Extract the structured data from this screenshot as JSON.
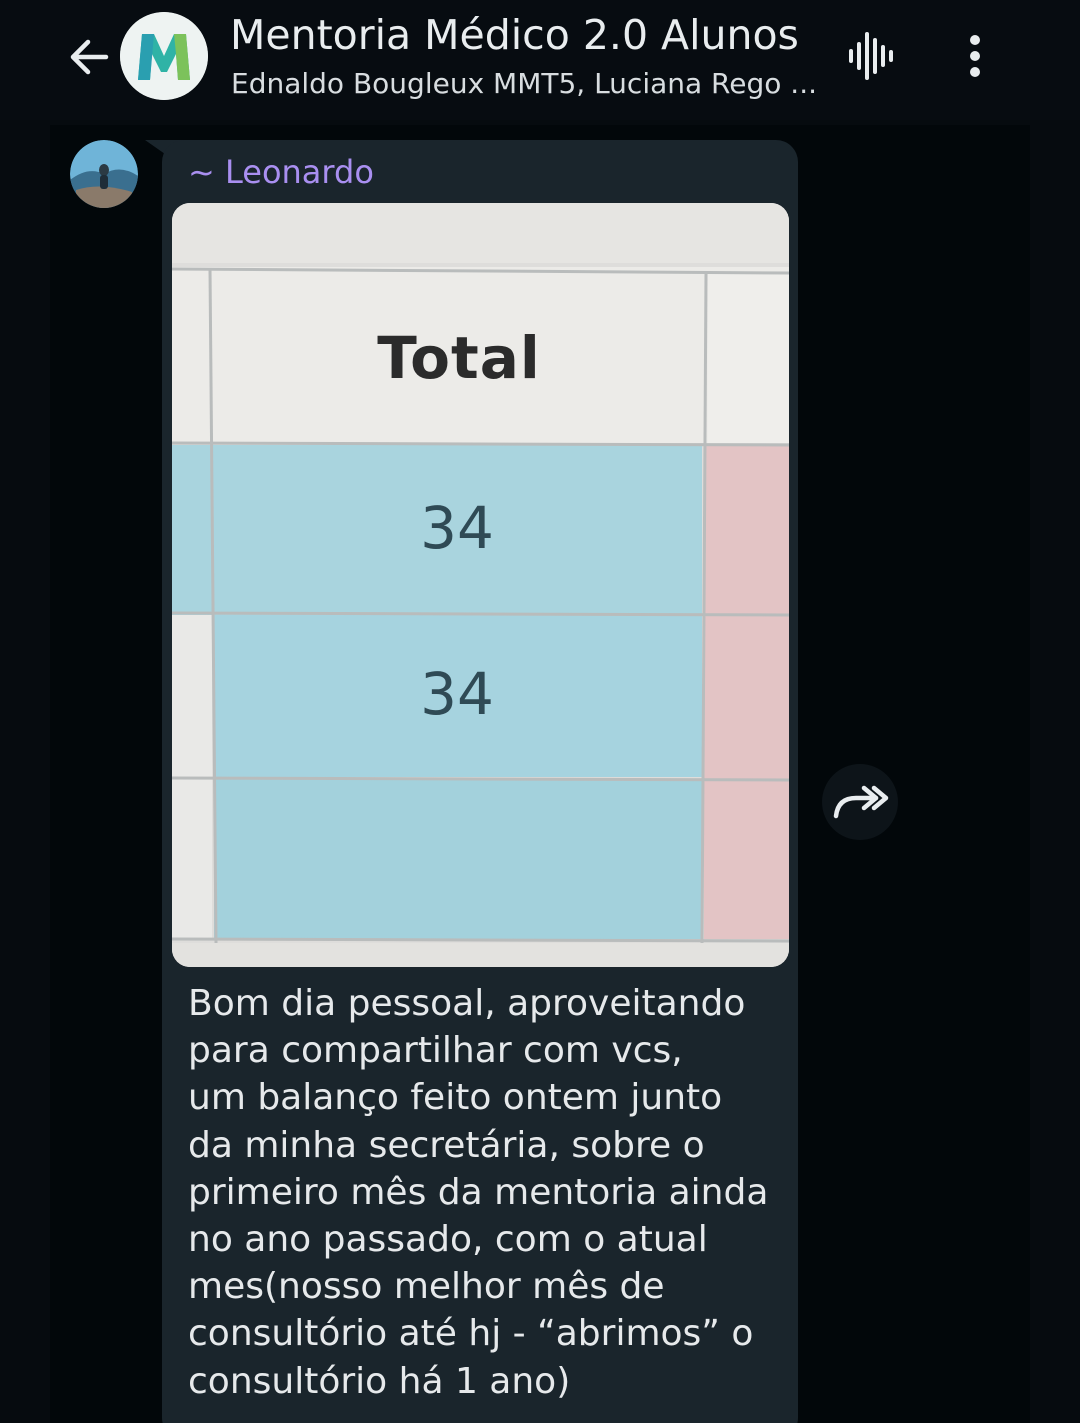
{
  "header": {
    "title": "Mentoria Médico 2.0 Alunos",
    "subtitle": "Ednaldo Bougleux MMT5, Luciana Rego ...",
    "avatar_letter": "M"
  },
  "message": {
    "sender": "~ Leonardo",
    "photo": {
      "header_label": "Total",
      "values": [
        "34",
        "34"
      ]
    },
    "text": "Bom dia pessoal, aproveitando\npara compartilhar com vcs,\num balanço feito ontem junto\nda minha secretária, sobre o\nprimeiro mês da mentoria ainda\nno ano passado, com o atual\nmes(nosso melhor mês de\nconsultório até hj - “abrimos” o\nconsultório há 1 ano)"
  },
  "icons": {
    "back": "arrow-left-icon",
    "voice": "voice-call-icon",
    "menu": "more-vertical-icon",
    "forward": "forward-icon"
  },
  "colors": {
    "background": "#060b0f",
    "bubble": "#1a252c",
    "sender_name": "#a98ff0",
    "text": "#e6e9eb",
    "cell_blue": "#acd6df",
    "cell_pink": "#e4c5c6"
  }
}
